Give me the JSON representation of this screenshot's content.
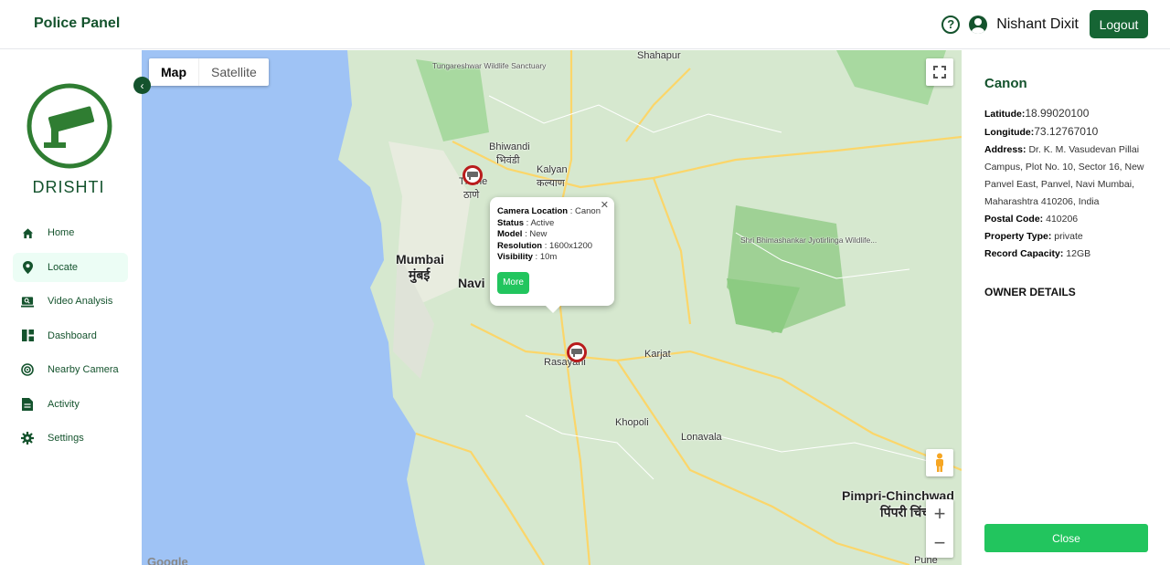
{
  "header": {
    "brand": "Police Panel",
    "user_name": "Nishant Dixit",
    "logout_label": "Logout"
  },
  "sidebar": {
    "logo_text": "DRISHTI",
    "items": [
      {
        "label": "Home",
        "icon": "home-icon"
      },
      {
        "label": "Locate",
        "icon": "location-pin-icon",
        "active": true
      },
      {
        "label": "Video Analysis",
        "icon": "video-analysis-icon"
      },
      {
        "label": "Dashboard",
        "icon": "dashboard-icon"
      },
      {
        "label": "Nearby Camera",
        "icon": "radar-icon"
      },
      {
        "label": "Activity",
        "icon": "document-icon"
      },
      {
        "label": "Settings",
        "icon": "gear-icon"
      }
    ]
  },
  "map": {
    "tabs": [
      "Map",
      "Satellite"
    ],
    "selected_tab": "Map",
    "labels": {
      "mumbai": "Mumbai",
      "mumbai_dev": "मुंबई",
      "navi": "Navi",
      "thane": "Thane",
      "thane_dev": "ठाणे",
      "bhiwandi": "Bhiwandi",
      "bhiwandi_dev": "भिवंडी",
      "kalyan": "Kalyan",
      "kalyan_dev": "कल्याण",
      "pimpri": "Pimpri-Chinchwad",
      "pimpri_dev": "पिंपरी चिंचवड",
      "panvel": "Rasayani",
      "karjat": "Karjat",
      "lonavala": "Lonavala",
      "khopoli": "Khopoli",
      "shahapur": "Shahapur",
      "tungareshwar": "Tungareshwar Wildlife Sanctuary",
      "bhimashankar": "Shri Bhimashankar Jyotirlinga Wildlife...",
      "pune": "Pune",
      "google": "Google"
    },
    "popup": {
      "camera_location_label": "Camera Location",
      "camera_location": "Canon",
      "status_label": "Status",
      "status": "Active",
      "model_label": "Model",
      "model": "New",
      "resolution_label": "Resolution",
      "resolution": "1600x1200",
      "visibility_label": "Visibility",
      "visibility": "10m",
      "more_label": "More"
    }
  },
  "details": {
    "title": "Canon",
    "latitude_label": "Latitude:",
    "latitude": "18.99020100",
    "longitude_label": "Longitude:",
    "longitude": "73.12767010",
    "address_label": "Address:",
    "address": "Dr. K. M. Vasudevan Pillai Campus, Plot No. 10, Sector 16, New Panvel East, Panvel, Navi Mumbai, Maharashtra 410206, India",
    "postal_label": "Postal Code:",
    "postal": "410206",
    "property_label": "Property Type:",
    "property": "private",
    "record_label": "Record Capacity:",
    "record": "12GB",
    "owner_title": "OWNER DETAILS",
    "close_label": "Close"
  },
  "colors": {
    "brand_green": "#14532d",
    "accent_green": "#22c55e",
    "marker_red": "#b91c1c"
  }
}
